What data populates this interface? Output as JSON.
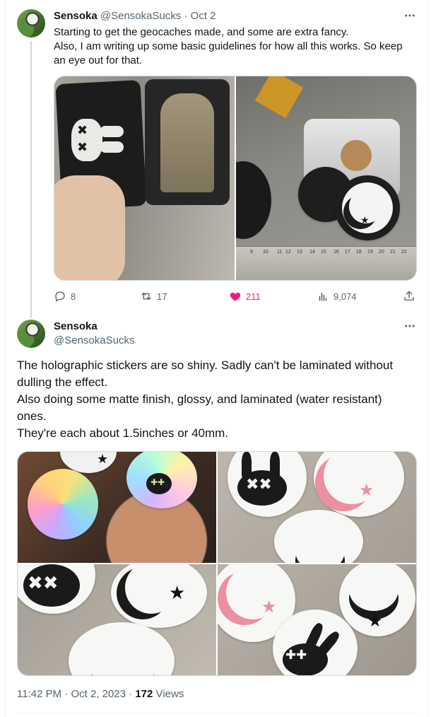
{
  "parent_tweet": {
    "display_name": "Sensoka",
    "handle": "@SensokaSucks",
    "separator": "·",
    "date": "Oct 2",
    "text_lines": [
      "Starting to get the geocaches made, and some are extra fancy.",
      "Also, I am writing up some basic guidelines for how all this works. So keep",
      "an eye out for that."
    ],
    "actions": {
      "replies": "8",
      "reposts": "17",
      "likes": "211",
      "views": "9,074"
    }
  },
  "main_tweet": {
    "display_name": "Sensoka",
    "handle": "@SensokaSucks",
    "text_lines": [
      "The holographic stickers are so shiny. Sadly can't be laminated without",
      "dulling the effect.",
      "Also doing some matte finish, glossy, and laminated (water resistant)",
      "ones.",
      "They're each about 1.5inches or 40mm."
    ],
    "meta": {
      "time": "11:42 PM",
      "separator": "·",
      "date": "Oct 2, 2023",
      "views_count": "172",
      "views_label": "Views"
    }
  },
  "icons": {
    "more": "more-horizontal-icon",
    "reply": "reply-icon",
    "repost": "repost-icon",
    "like": "heart-filled-icon",
    "views": "analytics-icon",
    "share": "share-icon"
  },
  "colors": {
    "like_accent": "#f91880",
    "muted_text": "#536471",
    "primary_text": "#0f1419",
    "border": "#cfd9de"
  }
}
